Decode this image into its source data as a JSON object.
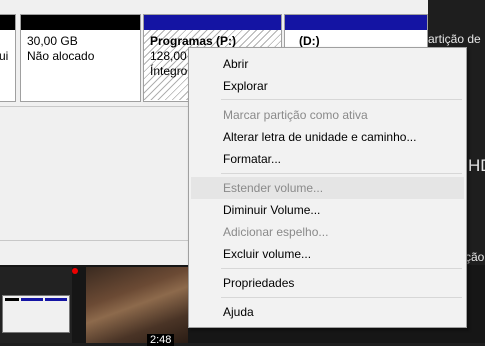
{
  "volumes": [
    {
      "size": "",
      "status": "ui"
    },
    {
      "size": "30,00 GB",
      "status": "Não alocado"
    },
    {
      "name": "Programas  (P:)",
      "size": "128,00",
      "status": "Íntegro"
    },
    {
      "name": "(D:)"
    }
  ],
  "side": {
    "partition": "artição de",
    "hd": "HD",
    "cao": "ção"
  },
  "video": {
    "timestamp": "2:48"
  },
  "context_menu": {
    "items": [
      {
        "label": "Abrir",
        "disabled": false
      },
      {
        "label": "Explorar",
        "disabled": false
      },
      {
        "label": "Marcar partição como ativa",
        "disabled": true
      },
      {
        "label": "Alterar letra de unidade e caminho...",
        "disabled": false
      },
      {
        "label": "Formatar...",
        "disabled": false
      },
      {
        "label": "Estender volume...",
        "disabled": true,
        "highlighted": true
      },
      {
        "label": "Diminuir Volume...",
        "disabled": false
      },
      {
        "label": "Adicionar espelho...",
        "disabled": true
      },
      {
        "label": "Excluir volume...",
        "disabled": false
      },
      {
        "label": "Propriedades",
        "disabled": false
      },
      {
        "label": "Ajuda",
        "disabled": false
      }
    ]
  },
  "colors": {
    "volume_bar_primary": "#1414a3",
    "volume_bar_unallocated": "#000000",
    "menu_bg": "#f2f2f2",
    "disabled_text": "#8a8a8a"
  }
}
